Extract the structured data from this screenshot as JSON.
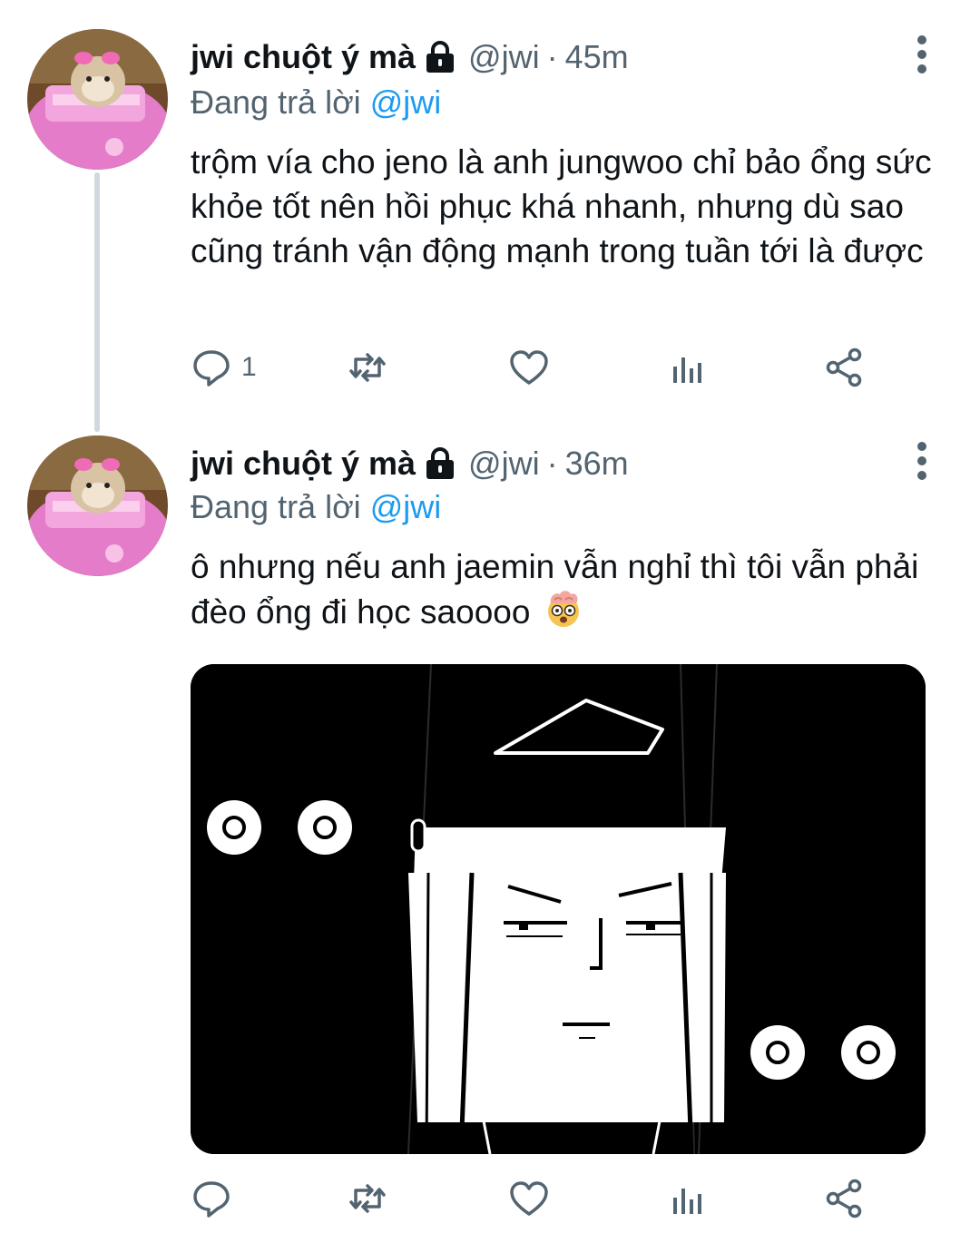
{
  "tweets": [
    {
      "display_name": "jwi chuột ý mà",
      "handle": "@jwi",
      "time_sep": "·",
      "time": "45m",
      "reply_prefix": "Đang trả lời",
      "reply_to": "@jwi",
      "text": "trộm vía cho jeno là anh jungwoo chỉ bảo ổng sức khỏe tốt nên hồi phục khá nhanh, nhưng dù sao cũng tránh vận động mạnh trong tuần tới là được",
      "reply_count": "1",
      "has_media": false
    },
    {
      "display_name": "jwi chuột ý mà",
      "handle": "@jwi",
      "time_sep": "·",
      "time": "36m",
      "reply_prefix": "Đang trả lời",
      "reply_to": "@jwi",
      "text": "ô nhưng nếu anh jaemin vẫn nghỉ thì tôi vẫn phải đèo ổng đi học saoooo",
      "emoji": "exploding-head-emoji",
      "reply_count": "",
      "has_media": true
    }
  ],
  "icons": {
    "lock": "lock-icon",
    "more": "more-vertical-icon",
    "reply": "reply-icon",
    "retweet": "retweet-icon",
    "like": "heart-icon",
    "analytics": "analytics-icon",
    "share": "share-icon"
  },
  "colors": {
    "text": "#0f1419",
    "secondary": "#536471",
    "accent": "#1d9bf0",
    "thread_line": "#cfd9de",
    "avatar_pink": "#e878c8"
  }
}
